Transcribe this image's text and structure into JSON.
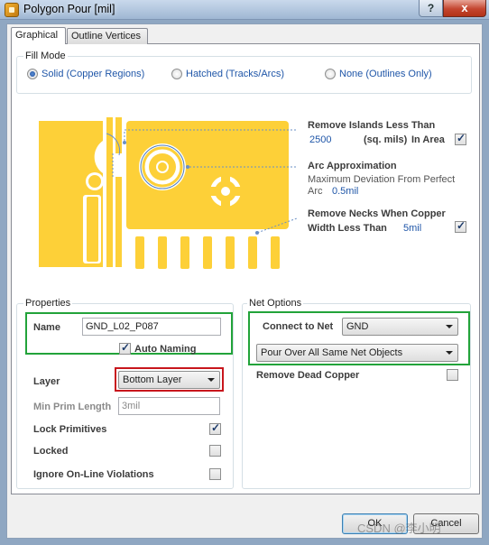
{
  "window": {
    "title": "Polygon Pour [mil]",
    "help_glyph": "?",
    "close_glyph": "x"
  },
  "tabs": [
    {
      "label": "Graphical",
      "active": true
    },
    {
      "label": "Outline Vertices",
      "active": false
    }
  ],
  "fill_mode": {
    "title": "Fill Mode",
    "options": [
      {
        "label": "Solid (Copper Regions)",
        "selected": true
      },
      {
        "label": "Hatched (Tracks/Arcs)",
        "selected": false
      },
      {
        "label": "None (Outlines Only)",
        "selected": false
      }
    ]
  },
  "graphic": {
    "copper_color": "#fdd038",
    "remove_islands": {
      "label": "Remove Islands Less Than",
      "value": "2500",
      "unit": "(sq. mils)",
      "in_area_label": "In Area",
      "in_area_checked": true
    },
    "arc_approx": {
      "label": "Arc Approximation",
      "desc": "Maximum Deviation From Perfect",
      "arc_label": "Arc",
      "value": "0.5mil"
    },
    "remove_necks": {
      "label": "Remove Necks When Copper",
      "width_label": "Width Less Than",
      "value": "5mil",
      "checked": true
    }
  },
  "properties": {
    "title": "Properties",
    "name_label": "Name",
    "name_value": "GND_L02_P087",
    "auto_naming_label": "Auto Naming",
    "auto_naming_checked": true,
    "layer_label": "Layer",
    "layer_value": "Bottom Layer",
    "min_prim_label": "Min Prim Length",
    "min_prim_value": "3mil",
    "lock_primitives_label": "Lock Primitives",
    "lock_primitives_checked": true,
    "locked_label": "Locked",
    "locked_checked": false,
    "ignore_online_label": "Ignore On-Line Violations",
    "ignore_online_checked": false
  },
  "net_options": {
    "title": "Net Options",
    "connect_label": "Connect to Net",
    "connect_value": "GND",
    "pour_over_value": "Pour Over All Same Net Objects",
    "remove_dead_label": "Remove Dead Copper",
    "remove_dead_checked": false
  },
  "buttons": {
    "ok": "OK",
    "cancel": "Cancel"
  },
  "watermark": "CSDN @李小明",
  "colors": {
    "highlight_green": "#22a33a",
    "highlight_red": "#c8161d",
    "link_blue": "#1f56a8"
  }
}
